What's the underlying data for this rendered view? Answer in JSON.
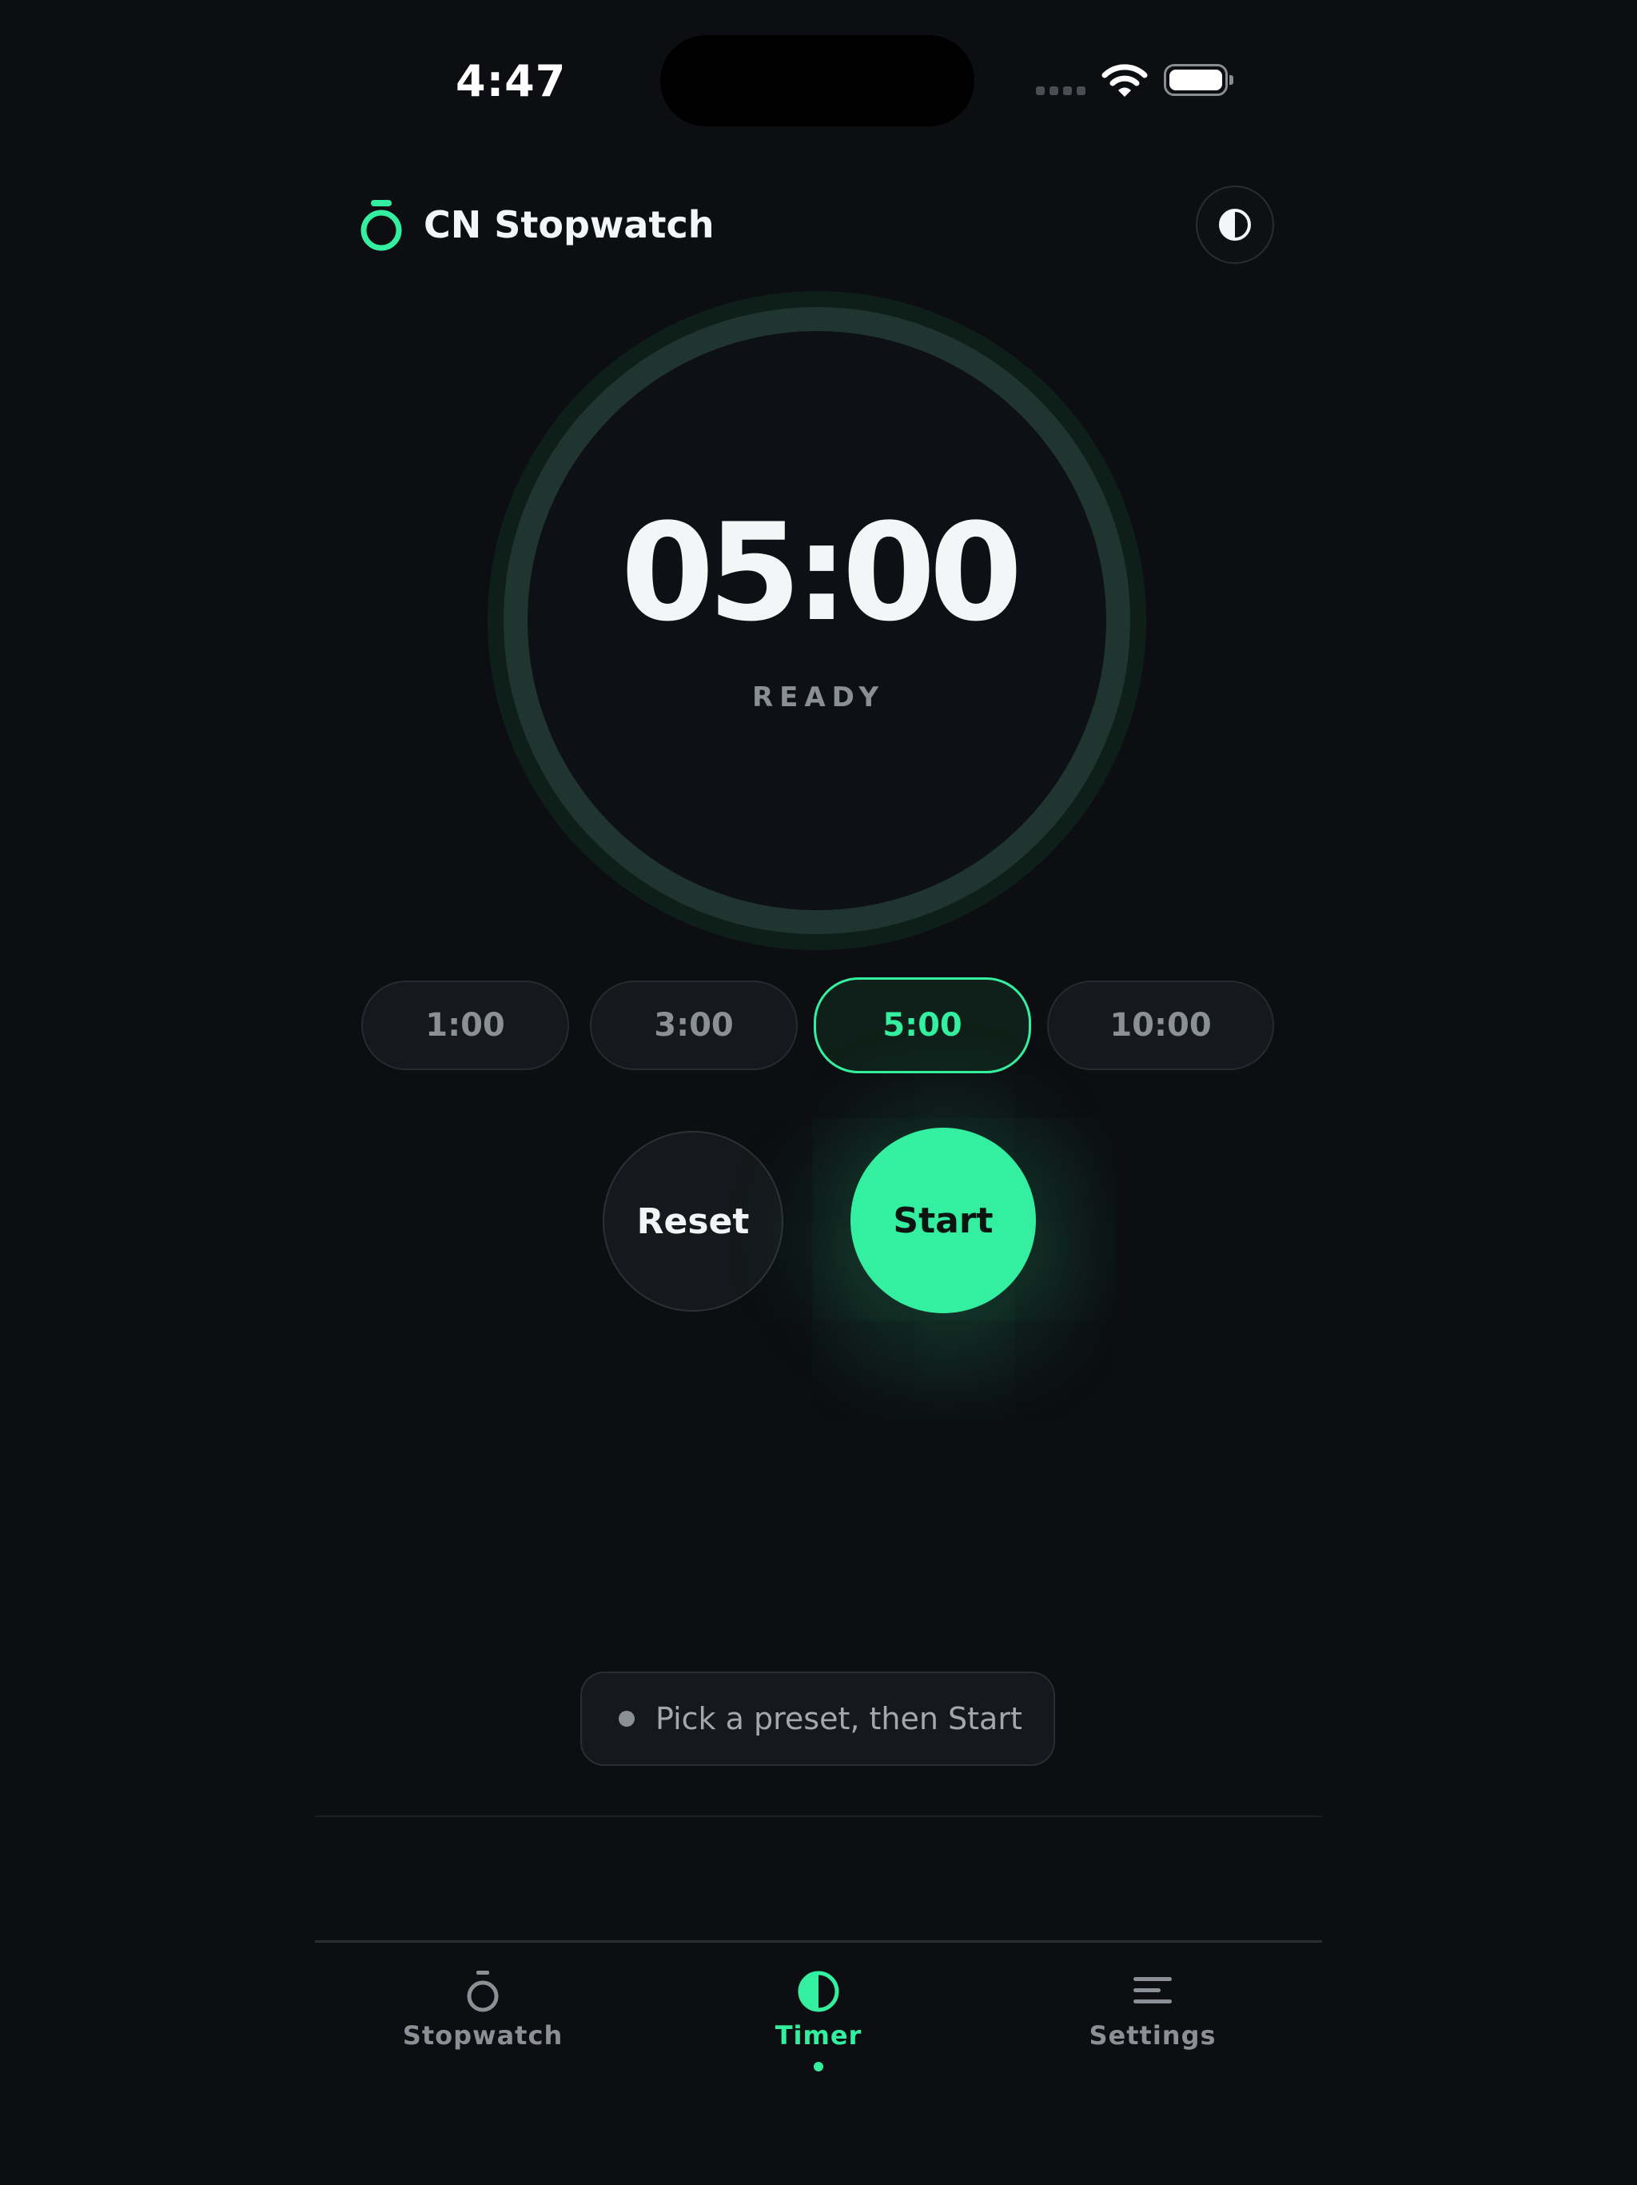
{
  "status_bar": {
    "time": "4:47",
    "signal_icon": "cellular-signal-icon",
    "wifi_icon": "wifi-icon",
    "battery_icon": "battery-icon"
  },
  "header": {
    "logo_icon": "stopwatch-icon",
    "title": "CN Stopwatch",
    "theme_toggle_icon": "contrast-icon"
  },
  "timer": {
    "display": "05:00",
    "state": "READY",
    "progress": 1.0
  },
  "presets": [
    {
      "label": "1:00",
      "selected": false
    },
    {
      "label": "3:00",
      "selected": false
    },
    {
      "label": "5:00",
      "selected": true
    },
    {
      "label": "10:00",
      "selected": false
    }
  ],
  "actions": {
    "reset_label": "Reset",
    "start_label": "Start"
  },
  "hint": {
    "text": "Pick a preset, then Start"
  },
  "tabs": [
    {
      "label": "Stopwatch",
      "icon": "stopwatch-icon",
      "active": false
    },
    {
      "label": "Timer",
      "icon": "timer-icon",
      "active": true
    },
    {
      "label": "Settings",
      "icon": "menu-lines-icon",
      "active": false
    }
  ],
  "colors": {
    "background": "#0c0e11",
    "accent": "#34ef9f",
    "surface": "#15181c",
    "muted_text": "#8b9096"
  }
}
